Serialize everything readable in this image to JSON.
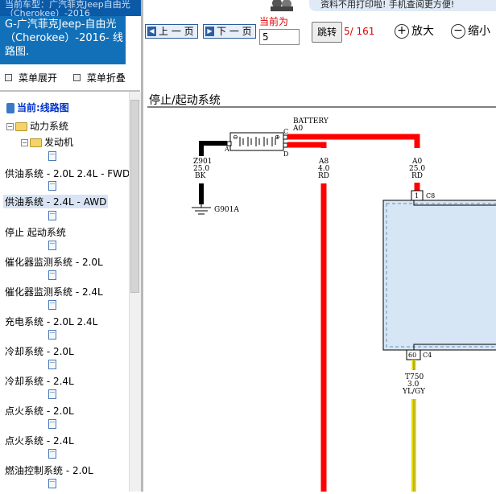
{
  "header": {
    "car_type_line1": "当前车型：广汽菲克Jeep自由光",
    "car_type_line2": "（Cherokee）-2016",
    "title": "G-广汽菲克Jeep-自由光（Cherokee）-2016- 线路图."
  },
  "menu": {
    "expand_label": "菜单展开",
    "collapse_label": "菜单折叠"
  },
  "tree": {
    "current_label": "当前:线路图",
    "nodes": [
      {
        "label": "动力系统"
      },
      {
        "label": "发动机"
      }
    ],
    "items": [
      {
        "label": "供油系统 - 2.0L 2.4L - FWD"
      },
      {
        "label": "供油系统 - 2.4L - AWD"
      },
      {
        "label": "停止 起动系统"
      },
      {
        "label": "催化器监测系统 - 2.0L"
      },
      {
        "label": "催化器监测系统 - 2.4L"
      },
      {
        "label": "充电系统 - 2.0L 2.4L"
      },
      {
        "label": "冷却系统 - 2.0L"
      },
      {
        "label": "冷却系统 - 2.4L"
      },
      {
        "label": "点火系统 - 2.0L"
      },
      {
        "label": "点火系统 - 2.4L"
      },
      {
        "label": "燃油控制系统 - 2.0L"
      }
    ]
  },
  "toolbar": {
    "prev_label": "上 一 页",
    "next_label": "下 一 页",
    "current_page_label": "当前为",
    "page_value": "5",
    "jump_label": "跳转",
    "page_count": "5/ 161",
    "zoom_in_label": "放大",
    "zoom_out_label": "缩小",
    "banner_text": "资料不用打印啦! 手机查阅更方便!"
  },
  "diagram": {
    "title": "停止/起动系统",
    "battery_label": "BATTERY",
    "battery_circuit": "A0",
    "pin_a": "A",
    "pin_c": "C",
    "pin_d": "D",
    "ground_wire": {
      "circuit": "Z901",
      "gauge": "25.0",
      "color": "BK"
    },
    "ground_label": "G901A",
    "wire_a8": {
      "circuit": "A8",
      "gauge": "4.0",
      "color": "RD"
    },
    "wire_a0": {
      "circuit": "A0",
      "gauge": "25.0",
      "color": "RD"
    },
    "connector_c8_pin": "1",
    "connector_c8": "C8",
    "connector_c4_pin": "60",
    "connector_c4": "C4",
    "wire_t750": {
      "circuit": "T750",
      "gauge": "3.0",
      "color": "YL/GY"
    }
  },
  "colors": {
    "title_bg": "#1270b8",
    "wire_red": "#ff0000",
    "wire_black": "#000000",
    "wire_yellow": "#e6d800",
    "module_fill": "#d6e6f5",
    "alert_red": "#e00000"
  },
  "icons": [
    "book-icon",
    "folder-icon",
    "page-icon",
    "zoom-in-icon",
    "zoom-out-icon",
    "prev-arrow-icon",
    "next-arrow-icon"
  ]
}
